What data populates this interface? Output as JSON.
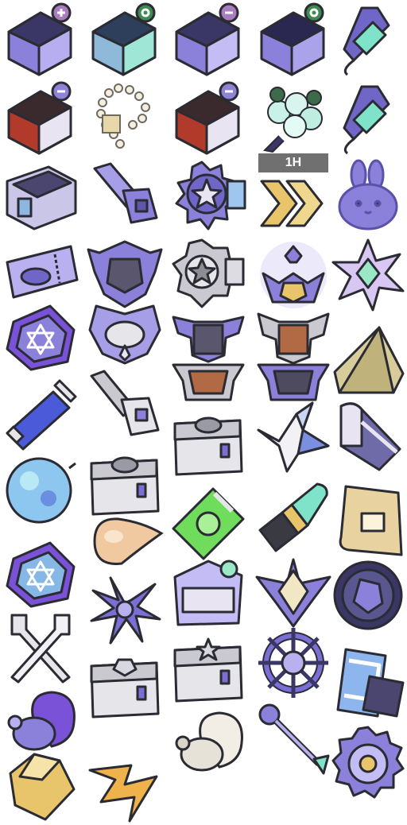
{
  "sheet": {
    "description_free": true,
    "items": [
      {
        "icon": "purple-chest-plus-icon"
      },
      {
        "icon": "teal-chest-lock-icon"
      },
      {
        "icon": "purple-chest-lock-icon"
      },
      {
        "icon": "navy-chest-lock-icon"
      },
      {
        "icon": "firework-rocket-icon"
      },
      {
        "icon": "red-chest-minus-icon"
      },
      {
        "icon": "pearl-bracelet-icon"
      },
      {
        "icon": "red-chest-minus-icon"
      },
      {
        "icon": "flower-bouquet-icon"
      },
      {
        "icon": "firework-rocket-icon"
      },
      {
        "icon": "open-crate-icon"
      },
      {
        "icon": "purple-key-card-icon"
      },
      {
        "icon": "star-gear-badge-icon"
      },
      {
        "icon": "gold-chevron-boost-icon",
        "badge": "1H"
      },
      {
        "icon": "bunny-cake-icon"
      },
      {
        "icon": "ticket-icon"
      },
      {
        "icon": "winged-frame-badge-icon"
      },
      {
        "icon": "silver-star-badge-icon"
      },
      {
        "icon": "crown-trophy-icon"
      },
      {
        "icon": "crystal-star-icon"
      },
      {
        "icon": "purple-hex-tile-icon"
      },
      {
        "icon": "helmet-wings-badge-icon"
      },
      {
        "icon": "silver-wings-badge-icon"
      },
      {
        "icon": "bronze-wings-badge-icon"
      },
      {
        "icon": "tan-shard-icon"
      },
      {
        "icon": "gray-key-card-icon"
      },
      {
        "icon": "bronze-shield-frame-icon"
      },
      {
        "icon": "silver-shield-frame-icon"
      },
      {
        "icon": "energy-capsule-icon"
      },
      {
        "icon": "silver-chest-icon"
      },
      {
        "icon": "paper-crane-icon"
      },
      {
        "icon": "cake-slice-icon"
      },
      {
        "icon": "spiked-orb-icon"
      },
      {
        "icon": "silver-chest-icon"
      },
      {
        "icon": "amber-drop-icon"
      },
      {
        "icon": "green-snack-pack-icon"
      },
      {
        "icon": "lipstick-icon"
      },
      {
        "icon": "fist-poster-icon"
      },
      {
        "icon": "blue-hex-tile-icon"
      },
      {
        "icon": "purple-lily-bouquet-icon"
      },
      {
        "icon": "love-letter-icon"
      },
      {
        "icon": "crystal-gem-emblem-icon"
      },
      {
        "icon": "gem-coin-icon"
      },
      {
        "icon": "crossed-forks-icon"
      },
      {
        "icon": "silver-gem-chest-icon"
      },
      {
        "icon": "silver-star-chest-icon"
      },
      {
        "icon": "ship-wheel-icon"
      },
      {
        "icon": "chocolate-bar-icon"
      },
      {
        "icon": "purple-turkey-icon"
      },
      {
        "icon": "white-turkey-icon"
      },
      {
        "icon": "purple-key-icon"
      },
      {
        "icon": "gold-diamond-icon"
      },
      {
        "icon": "lightning-bolt-icon"
      },
      {
        "icon": "purple-gear-icon"
      }
    ]
  },
  "colors": {
    "purple": "#7b6fd6",
    "lavender": "#b9b0f0",
    "navy": "#2f2c55",
    "teal": "#7ee3c9",
    "red": "#b23a2a",
    "gold": "#e8c46a",
    "silver": "#c9c9cf",
    "bronze": "#b26a45",
    "green": "#6fdc5c",
    "outline": "#2b2b33"
  }
}
